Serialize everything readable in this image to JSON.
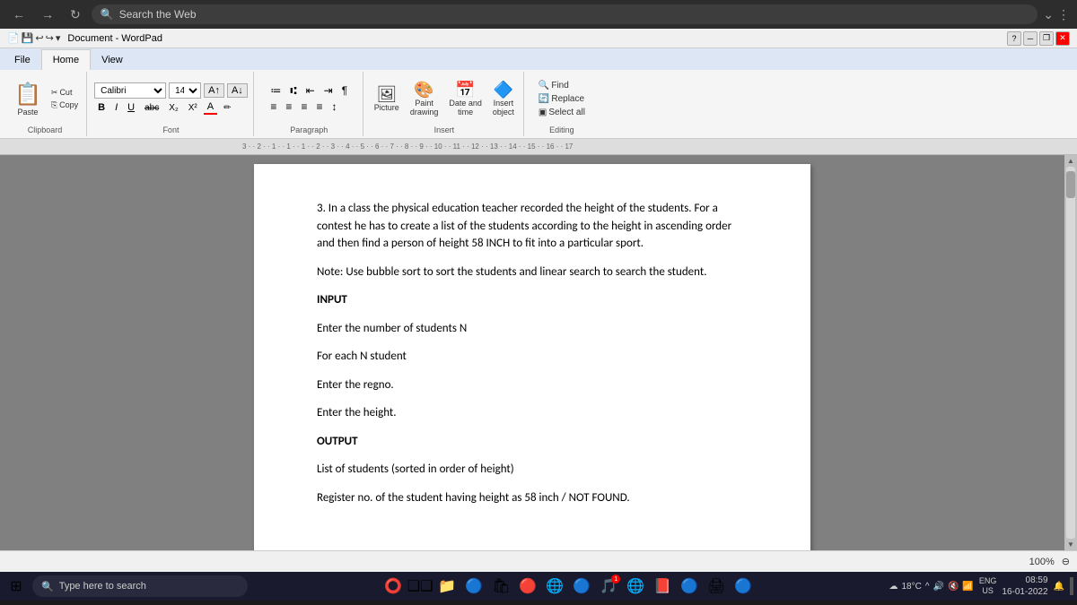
{
  "browser": {
    "search_placeholder": "Search the Web",
    "nav_back": "←",
    "nav_forward": "→",
    "nav_refresh": "↻",
    "more_icon": "⋮",
    "down_icon": "⌄"
  },
  "titlebar": {
    "title": "Document - WordPad",
    "minimize": "─",
    "restore": "❐",
    "close": "✕",
    "help": "?"
  },
  "ribbon": {
    "tabs": [
      "File",
      "Home",
      "View"
    ],
    "active_tab": "Home",
    "groups": {
      "clipboard": {
        "label": "Clipboard",
        "paste": "Paste",
        "cut": "✂ Cut",
        "copy": "⎘ Copy"
      },
      "font": {
        "label": "Font",
        "font_name": "Calibri",
        "font_size": "14",
        "bold": "B",
        "italic": "I",
        "underline": "U",
        "strikethrough": "abc",
        "subscript": "X₂",
        "superscript": "X²",
        "text_color": "A"
      },
      "paragraph": {
        "label": "Paragraph",
        "list_icons": [
          "≡",
          "≡",
          "≡",
          "≡"
        ],
        "align_icons": [
          "≡",
          "≡",
          "≡",
          "≡",
          "≡"
        ]
      },
      "insert": {
        "label": "Insert",
        "picture": "Picture",
        "paint": "Paint\ndrawing",
        "date_time": "Date and\ntime",
        "object": "Insert\nobject"
      },
      "editing": {
        "label": "Editing",
        "find": "🔍 Find",
        "replace": "Replace",
        "select_all": "Select all"
      }
    }
  },
  "document": {
    "content": {
      "paragraph1": "3. In a class the physical education teacher recorded the height of the students.  For a contest he has to create a list of the students according to the height in ascending order and then find a person of height 58 INCH to fit into a particular sport.",
      "note": "Note: Use bubble sort to sort the students and linear search to search the student.",
      "input_header": "INPUT",
      "input_line1": "Enter the number of students N",
      "input_line2": "For each N student",
      "input_line3": "Enter the regno.",
      "input_line4": "Enter the height.",
      "output_header": "OUTPUT",
      "output_line1": "List of students (sorted in order of height)",
      "output_line2": "Register no. of the student having height as 58 inch / NOT FOUND."
    }
  },
  "statusbar": {
    "zoom": "100%",
    "zoom_minus": "⊖"
  },
  "taskbar": {
    "start_icon": "⊞",
    "search_text": "Type here to search",
    "search_icon": "🔍",
    "temperature": "18°C",
    "time": "08:59",
    "date": "16-01-2022",
    "lang": "ENG\nUS",
    "icons": [
      "⊞",
      "📁",
      "🔵",
      "📁",
      "🔴",
      "🌐",
      "🔵",
      "🎵",
      "🔴",
      "🌐",
      "🔵",
      "🖨",
      "🔵",
      "🟤"
    ],
    "notification_count": "1"
  }
}
